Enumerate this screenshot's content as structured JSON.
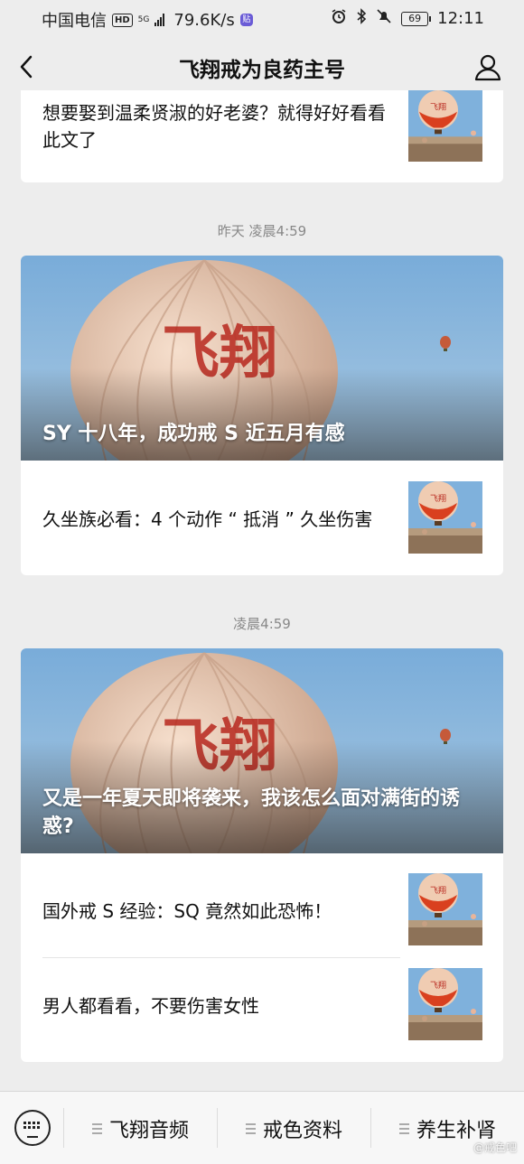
{
  "status_bar": {
    "carrier": "中国电信",
    "hd": "HD",
    "network": "5G",
    "speed": "79.6K/s",
    "app_badge": "贴",
    "battery": "69",
    "time": "12:11"
  },
  "nav": {
    "title": "飞翔戒为良药主号"
  },
  "balloon_text": "飞翔",
  "articles": {
    "first_card": {
      "title": "想要娶到温柔贤淑的好老婆？就得好好看看此文了"
    },
    "group1": {
      "time": "昨天 凌晨4:59",
      "hero_title": "SY 十八年，成功戒 S 近五月有感",
      "items": [
        {
          "title": "久坐族必看：4 个动作 “ 抵消 ” 久坐伤害"
        }
      ]
    },
    "group2": {
      "time": "凌晨4:59",
      "hero_title": "又是一年夏天即将袭来，我该怎么面对满街的诱惑?",
      "items": [
        {
          "title": "国外戒 S 经验：SQ 竟然如此恐怖！"
        },
        {
          "title": "男人都看看，不要伤害女性"
        }
      ]
    }
  },
  "menu": {
    "items": [
      "飞翔音频",
      "戒色资料",
      "养生补肾"
    ]
  },
  "watermark": "@戒色吧",
  "icons": {
    "back": "chevron-left-icon",
    "user": "user-profile-icon",
    "keyboard": "keyboard-icon",
    "menu_list": "menu-list-icon"
  },
  "colors": {
    "background": "#ededed",
    "card": "#ffffff",
    "sky": "#7fb1dc",
    "balloon": "#f2cdb3",
    "balloon_text": "#b8281e"
  }
}
